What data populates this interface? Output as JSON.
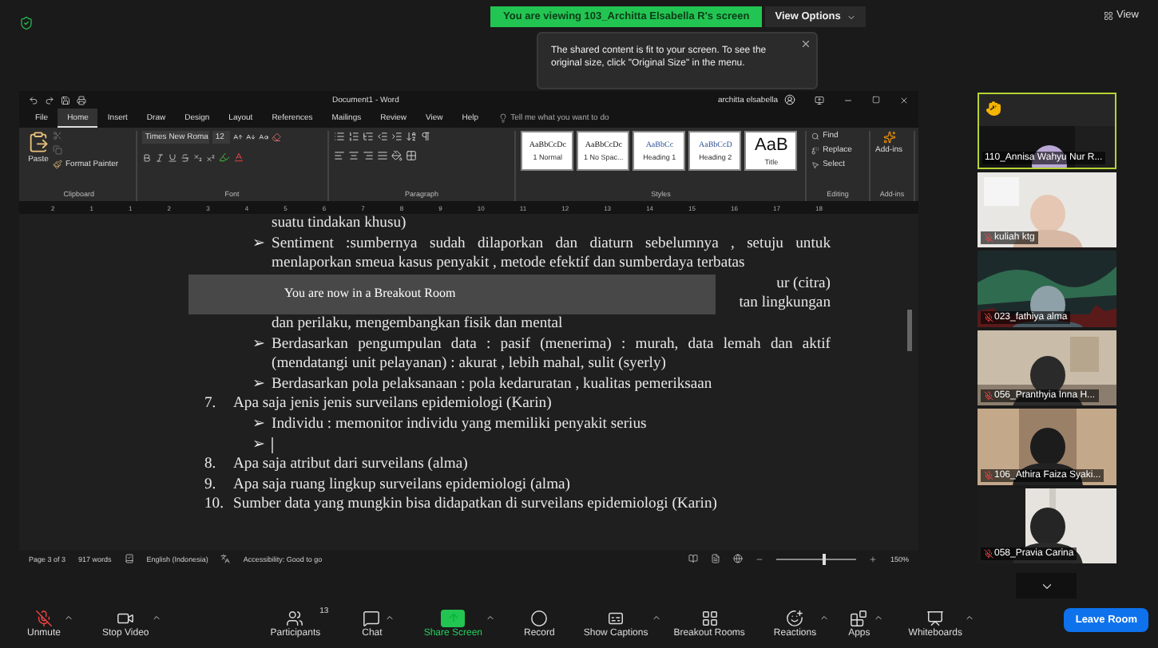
{
  "top_bar": {
    "banner": "You are viewing 103_Architta Elsabella R's screen",
    "view_options": "View Options",
    "view_button": "View"
  },
  "notice": {
    "text": "The shared content is fit to your screen. To see the original size, click \"Original Size\" in the menu."
  },
  "word": {
    "title": "Document1  -  Word",
    "user": "architta elsabella",
    "search": "Tell me what you want to do",
    "tabs": [
      {
        "label": "File",
        "selected": false
      },
      {
        "label": "Home",
        "selected": true
      },
      {
        "label": "Insert",
        "selected": false
      },
      {
        "label": "Draw",
        "selected": false
      },
      {
        "label": "Design",
        "selected": false
      },
      {
        "label": "Layout",
        "selected": false
      },
      {
        "label": "References",
        "selected": false
      },
      {
        "label": "Mailings",
        "selected": false
      },
      {
        "label": "Review",
        "selected": false
      },
      {
        "label": "View",
        "selected": false
      },
      {
        "label": "Help",
        "selected": false
      }
    ],
    "ribbon": {
      "paste": "Paste",
      "format_painter": "Format Painter",
      "font_name": "Times New Roma",
      "font_size": "12",
      "styles": [
        {
          "sample": "AaBbCcDc",
          "name": "1 Normal"
        },
        {
          "sample": "AaBbCcDc",
          "name": "1 No Spac..."
        },
        {
          "sample": "AaBbCc",
          "name": "Heading 1"
        },
        {
          "sample": "AaBbCcD",
          "name": "Heading 2"
        },
        {
          "sample": "AaB",
          "name": "Title"
        }
      ],
      "editing": [
        "Find",
        "Replace",
        "Select"
      ],
      "addins": "Add-ins",
      "groups": [
        "Clipboard",
        "Font",
        "Paragraph",
        "Styles",
        "Editing",
        "Add-ins"
      ]
    },
    "ruler": [
      "2",
      "1",
      "1",
      "2",
      "3",
      "4",
      "5",
      "6",
      "7",
      "8",
      "9",
      "10",
      "11",
      "12",
      "13",
      "14",
      "15",
      "16",
      "17",
      "18"
    ],
    "document": [
      {
        "kind": "continuation",
        "text": "suatu tindakan khusu)"
      },
      {
        "kind": "bullet",
        "marker": "➢",
        "text": "Sentiment :sumbernya sudah dilaporkan dan diaturn sebelumnya , setuju untuk menlaporkan smeua kasus penyakit , metode efektif dan sumberdaya terbatas"
      },
      {
        "kind": "covered",
        "fragments": [
          "ur (citra)",
          "tan lingkungan"
        ]
      },
      {
        "kind": "continuation",
        "text": "dan perilaku, mengembangkan fisik dan mental"
      },
      {
        "kind": "bullet",
        "marker": "➢",
        "text": "Berdasarkan pengumpulan data : pasif (menerima) : murah, data lemah dan aktif (mendatangi unit pelayanan) : akurat , lebih mahal, sulit (syerly)"
      },
      {
        "kind": "bullet",
        "marker": "➢",
        "text": "Berdasarkan pola pelaksanaan : pola kedaruratan , kualitas pemeriksaan"
      },
      {
        "kind": "numbered",
        "number": "7.",
        "text": "Apa saja jenis jenis surveilans epidemiologi (Karin)"
      },
      {
        "kind": "bullet",
        "marker": "➢",
        "text": "Individu : memonitor individu yang memiliki penyakit serius"
      },
      {
        "kind": "empty-bullet",
        "marker": "➢"
      },
      {
        "kind": "numbered",
        "number": "8.",
        "text": "Apa saja atribut dari surveilans (alma)"
      },
      {
        "kind": "numbered",
        "number": "9.",
        "text": "Apa saja ruang lingkup surveilans epidemiologi (alma)"
      },
      {
        "kind": "numbered",
        "number": "10.",
        "text": "Sumber data yang mungkin bisa didapatkan di surveilans epidemiologi (Karin)"
      }
    ],
    "status": {
      "page": "Page 3 of 3",
      "words": "917 words",
      "language": "English (Indonesia)",
      "accessibility": "Accessibility: Good to go",
      "zoom": "150%",
      "zoom_slider": {
        "level": 0.58
      }
    }
  },
  "overlay": "You are now in a Breakout Room",
  "participants": [
    {
      "name": "110_Annisa Wahyu Nur R...",
      "hand_raised": true,
      "muted": false,
      "highlighted": true
    },
    {
      "name": "kuliah ktg",
      "hand_raised": false,
      "muted": true,
      "highlighted": false
    },
    {
      "name": "023_fathiya alma",
      "hand_raised": false,
      "muted": true,
      "highlighted": false
    },
    {
      "name": "056_Pranthyia Inna H...",
      "hand_raised": false,
      "muted": true,
      "highlighted": false
    },
    {
      "name": "106_Athira Faiza Syaki...",
      "hand_raised": false,
      "muted": true,
      "highlighted": false
    },
    {
      "name": "058_Pravia Carina",
      "hand_raised": false,
      "muted": true,
      "highlighted": false
    }
  ],
  "toolbar": [
    {
      "kind": "mic-muted",
      "label": "Unmute",
      "caret": true
    },
    {
      "kind": "video",
      "label": "Stop Video",
      "caret": true
    },
    {
      "kind": "participants",
      "label": "Participants",
      "count": "13",
      "caret": false
    },
    {
      "kind": "chat",
      "label": "Chat",
      "caret": true
    },
    {
      "kind": "share",
      "label": "Share Screen",
      "caret": true
    },
    {
      "kind": "record",
      "label": "Record",
      "caret": false
    },
    {
      "kind": "captions",
      "label": "Show Captions",
      "caret": true
    },
    {
      "kind": "breakout",
      "label": "Breakout Rooms",
      "caret": false
    },
    {
      "kind": "reactions",
      "label": "Reactions",
      "caret": true
    },
    {
      "kind": "apps",
      "label": "Apps",
      "caret": true
    },
    {
      "kind": "whiteboards",
      "label": "Whiteboards",
      "caret": true
    }
  ],
  "leave_button": "Leave Room"
}
